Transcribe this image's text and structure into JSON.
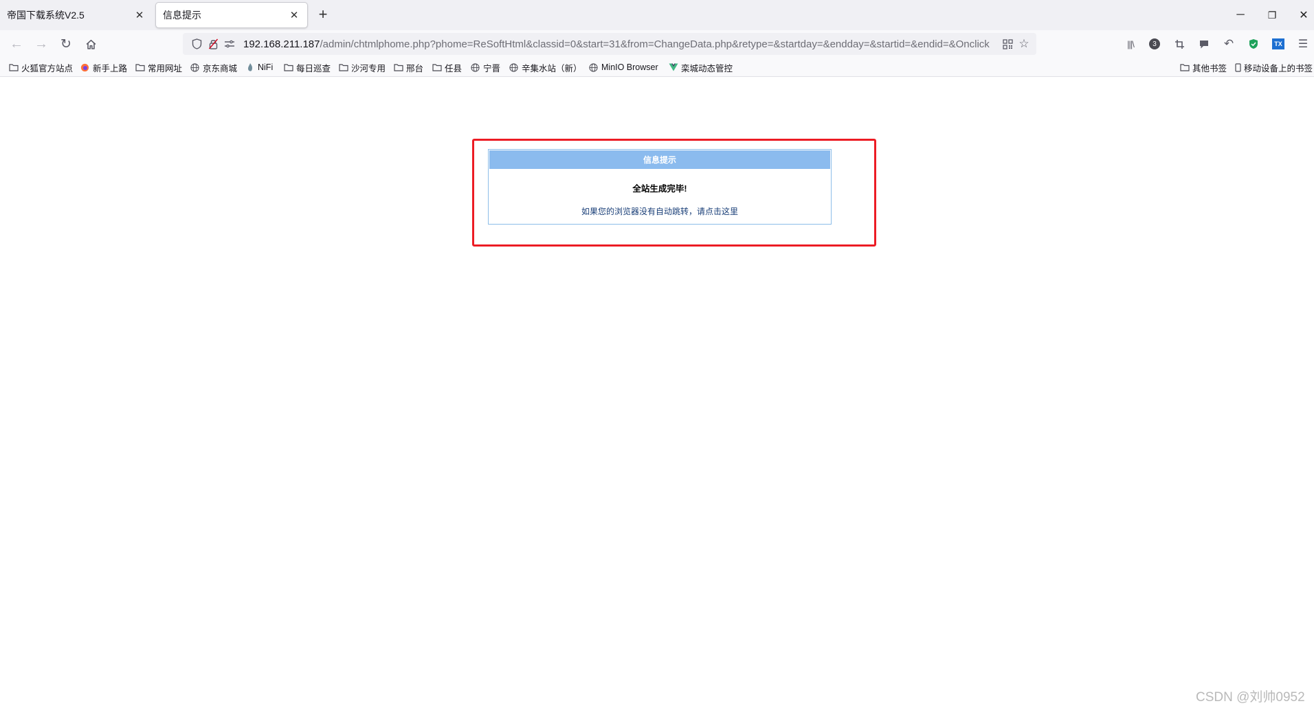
{
  "tabs": [
    {
      "label": "帝国下载系统V2.5",
      "active": false
    },
    {
      "label": "信息提示",
      "active": true
    }
  ],
  "window_controls": {
    "minimize": "─",
    "maximize": "❐",
    "close": "✕"
  },
  "nav": {
    "back": "←",
    "forward": "→",
    "reload": "↻"
  },
  "urlbar": {
    "host": "192.168.211.187",
    "path": "/admin/chtmlphome.php?phome=ReSoftHtml&classid=0&start=31&from=ChangeData.php&retype=&startday=&endday=&startid=&endid=&Onclick"
  },
  "bookmarks": [
    {
      "label": "火狐官方站点",
      "icon": "folder-icon"
    },
    {
      "label": "新手上路",
      "icon": "firefox-icon"
    },
    {
      "label": "常用网址",
      "icon": "folder-icon"
    },
    {
      "label": "京东商城",
      "icon": "globe-icon"
    },
    {
      "label": "NiFi",
      "icon": "nifi-icon"
    },
    {
      "label": "每日巡查",
      "icon": "folder-icon"
    },
    {
      "label": "沙河专用",
      "icon": "folder-icon"
    },
    {
      "label": "邢台",
      "icon": "folder-icon"
    },
    {
      "label": "任县",
      "icon": "folder-icon"
    },
    {
      "label": "宁晋",
      "icon": "globe-icon"
    },
    {
      "label": "辛集水站（新）",
      "icon": "globe-icon"
    },
    {
      "label": "MinIO Browser",
      "icon": "globe-icon"
    },
    {
      "label": "栾城动态管控",
      "icon": "vue-icon"
    }
  ],
  "bookmarks_right": [
    {
      "label": "其他书签",
      "icon": "folder-icon"
    },
    {
      "label": "移动设备上的书签",
      "icon": "mobile-icon"
    }
  ],
  "toolbar_icons": {
    "extension_badge": "3",
    "tx": "TX"
  },
  "message": {
    "header": "信息提示",
    "title": "全站生成完毕!",
    "link": "如果您的浏览器没有自动跳转，请点击这里"
  },
  "watermark": "CSDN @刘帅0952",
  "colors": {
    "highlight_border": "#ec1c24",
    "header_bg": "#8bbbee",
    "link": "#1a3f78"
  }
}
